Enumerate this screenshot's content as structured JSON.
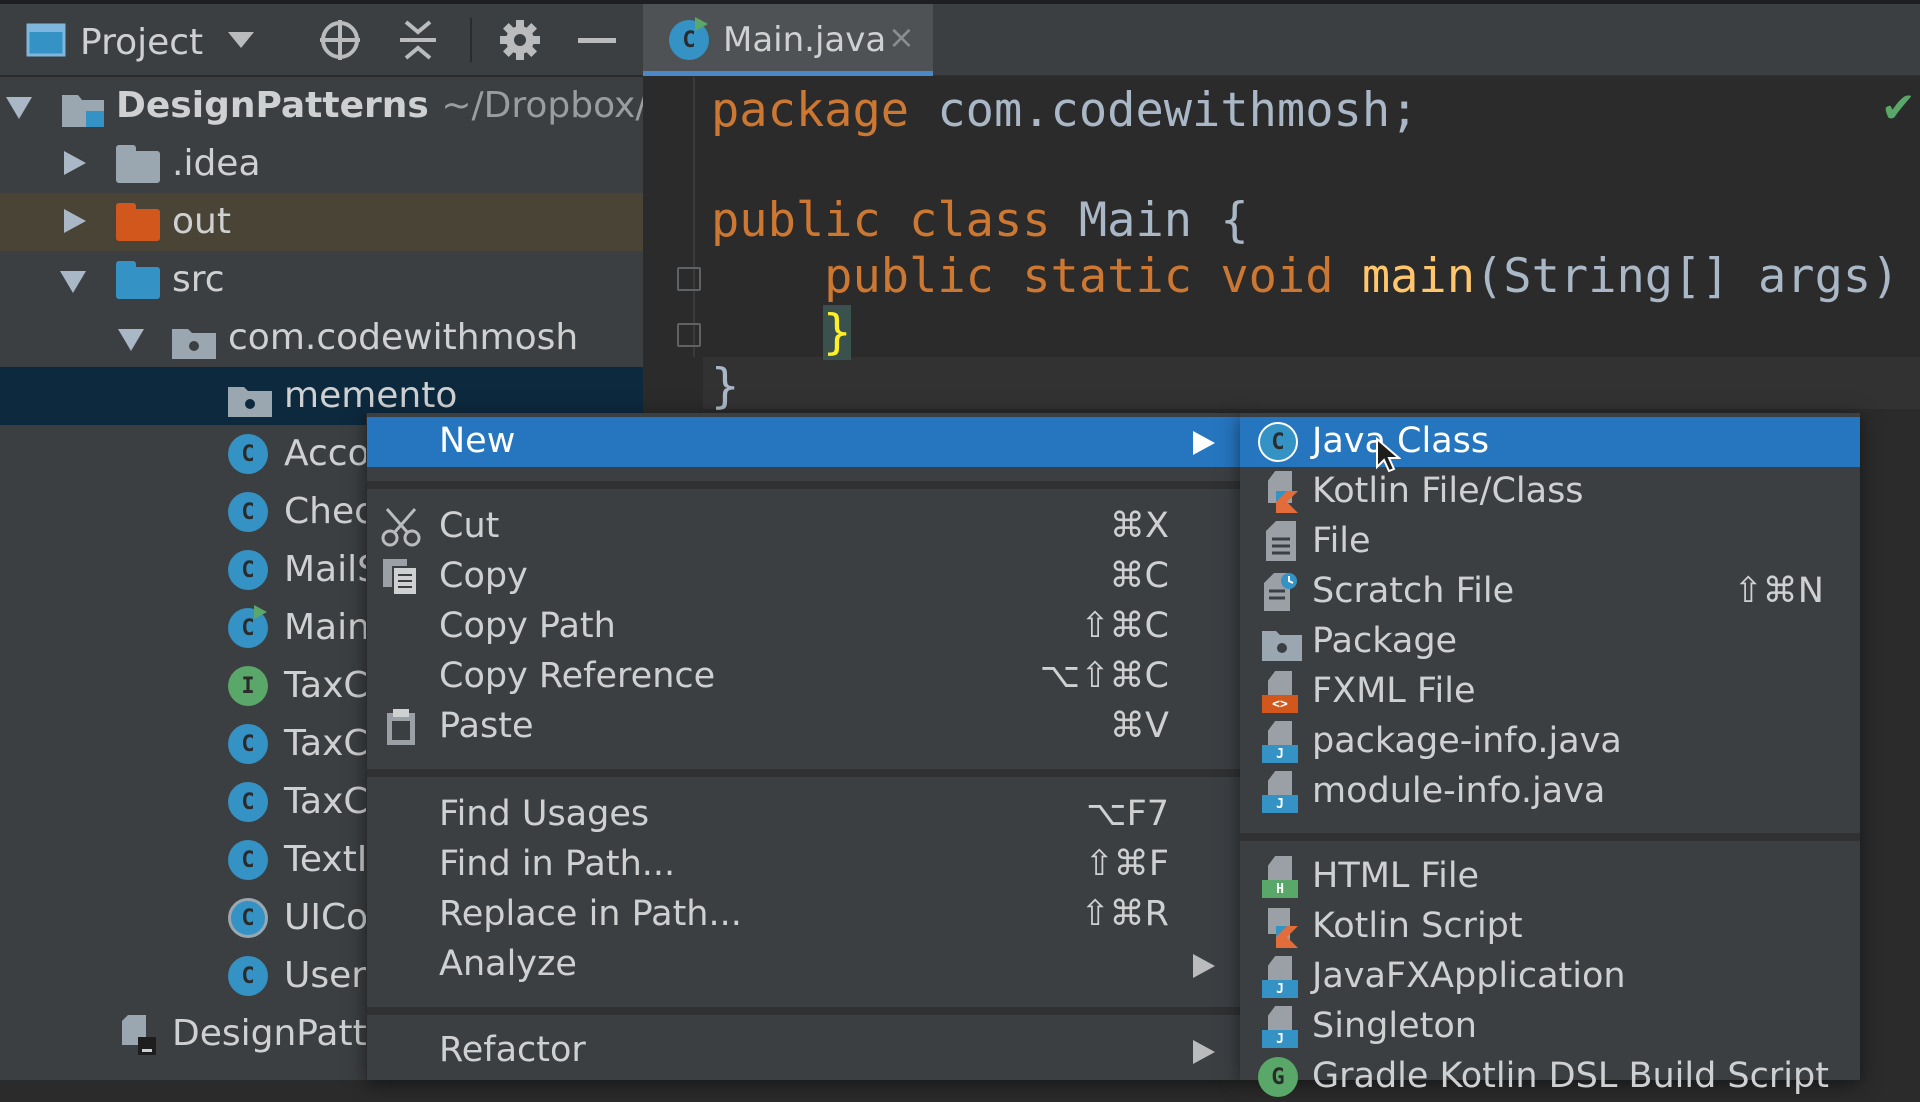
{
  "project_pane": {
    "title": "Project",
    "tree": [
      {
        "label": "DesignPatterns",
        "path": "~/Dropbox/Co"
      },
      {
        "label": ".idea"
      },
      {
        "label": "out"
      },
      {
        "label": "src"
      },
      {
        "label": "com.codewithmosh"
      },
      {
        "label": "memento"
      },
      {
        "label": "Acco"
      },
      {
        "label": "Chec"
      },
      {
        "label": "MailS"
      },
      {
        "label": "Main"
      },
      {
        "label": "TaxC"
      },
      {
        "label": "TaxC"
      },
      {
        "label": "TaxC"
      },
      {
        "label": "TextI"
      },
      {
        "label": "UICo"
      },
      {
        "label": "User"
      },
      {
        "label": "DesignPatte"
      }
    ],
    "badges": {
      "class": "C",
      "interface": "I"
    }
  },
  "editor": {
    "tab_label": "Main.java",
    "tab_close": "×",
    "code": {
      "l1_kw": "package",
      "l1_rest": " com.codewithmosh;",
      "l3_kw": "public class",
      "l3_rest": " Main {",
      "l4_kw": "    public static void",
      "l4_fn": " main",
      "l4_rest": "(String[] args) ",
      "l5_brace": "}",
      "l6": "}"
    }
  },
  "context_menu": {
    "new": "New",
    "cut": {
      "label": "Cut",
      "shortcut": "⌘X"
    },
    "copy": {
      "label": "Copy",
      "shortcut": "⌘C"
    },
    "copy_path": {
      "label": "Copy Path",
      "shortcut": "⇧⌘C"
    },
    "copy_reference": {
      "label": "Copy Reference",
      "shortcut": "⌥⇧⌘C"
    },
    "paste": {
      "label": "Paste",
      "shortcut": "⌘V"
    },
    "find_usages": {
      "label": "Find Usages",
      "shortcut": "⌥F7"
    },
    "find_in_path": {
      "label": "Find in Path...",
      "shortcut": "⇧⌘F"
    },
    "replace_in_path": {
      "label": "Replace in Path...",
      "shortcut": "⇧⌘R"
    },
    "analyze": "Analyze",
    "refactor": "Refactor"
  },
  "new_submenu": {
    "java_class": "Java Class",
    "kotlin_file": "Kotlin File/Class",
    "file": "File",
    "scratch_file": {
      "label": "Scratch File",
      "shortcut": "⇧⌘N"
    },
    "package": "Package",
    "fxml_file": "FXML File",
    "package_info": "package-info.java",
    "module_info": "module-info.java",
    "html_file": "HTML File",
    "kotlin_script": "Kotlin Script",
    "javafx_app": "JavaFXApplication",
    "singleton": "Singleton",
    "gradle_kotlin": "Gradle Kotlin DSL Build Script",
    "tags": {
      "html": "H",
      "java": "J",
      "fxml": "<>",
      "gradle": "G"
    }
  },
  "colors": {
    "selection": "#2675bf",
    "keyword": "#cc7832",
    "function": "#ffc66d",
    "class_icon": "#3592c4"
  }
}
